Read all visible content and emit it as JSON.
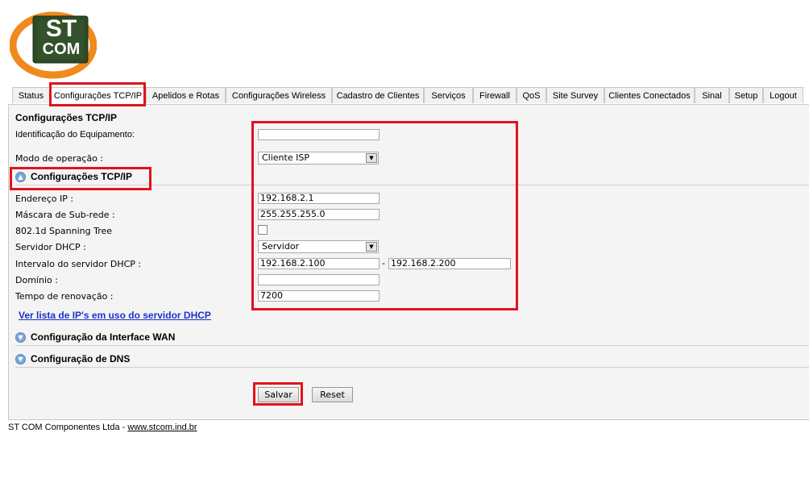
{
  "logo": {
    "line1": "ST",
    "line2": "COM"
  },
  "tabs": [
    {
      "label": "Status"
    },
    {
      "label": "Configurações TCP/IP"
    },
    {
      "label": "Apelidos e Rotas"
    },
    {
      "label": "Configurações Wireless"
    },
    {
      "label": "Cadastro de Clientes"
    },
    {
      "label": "Serviços"
    },
    {
      "label": "Firewall"
    },
    {
      "label": "QoS"
    },
    {
      "label": "Site Survey"
    },
    {
      "label": "Clientes Conectados"
    },
    {
      "label": "Sinal"
    },
    {
      "label": "Setup"
    },
    {
      "label": "Logout"
    }
  ],
  "panel": {
    "heading": "Configurações TCP/IP",
    "device_id_label": "Identificação do Equipamento:",
    "device_id_value": "",
    "mode_label": "Modo de operação :",
    "mode_value": "Cliente ISP",
    "section_tcpip": "Configurações TCP/IP",
    "ip_label": "Endereço IP :",
    "ip_value": "192.168.2.1",
    "mask_label": "Máscara de Sub-rede :",
    "mask_value": "255.255.255.0",
    "stp_label": "802.1d Spanning Tree",
    "dhcp_label": "Servidor DHCP :",
    "dhcp_value": "Servidor",
    "range_label": "Intervalo do servidor DHCP :",
    "range_start": "192.168.2.100",
    "range_sep": "-",
    "range_end": "192.168.2.200",
    "domain_label": "Domínio :",
    "domain_value": "",
    "lease_label": "Tempo de renovação :",
    "lease_value": "7200",
    "dhcp_list_link": "Ver lista de IP's em uso do servidor DHCP",
    "section_wan": "Configuração da Interface WAN",
    "section_dns": "Configuração de DNS",
    "save_label": "Salvar",
    "reset_label": "Reset"
  },
  "footer": {
    "company": "ST COM Componentes Ltda - ",
    "url": "www.stcom.ind.br"
  },
  "colors": {
    "highlight": "#e0131b",
    "accent": "#f08a1c",
    "logo_green": "#2d4a26",
    "link": "#1a33cc"
  }
}
